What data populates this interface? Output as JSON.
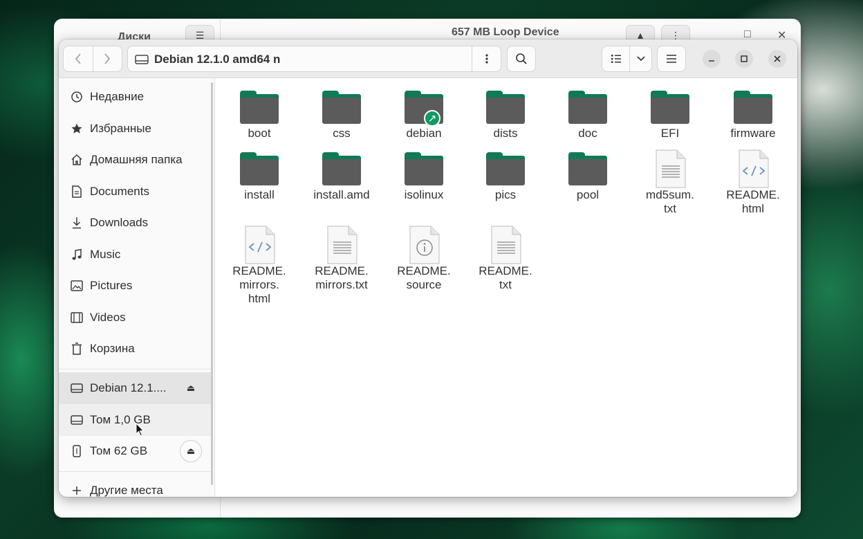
{
  "background_window": {
    "sidebar_title": "Диски",
    "title": "657 MB Loop Device"
  },
  "header": {
    "path": "Debian 12.1.0 amd64 n"
  },
  "sidebar": {
    "items": [
      {
        "label": "Недавние",
        "icon": "clock-icon"
      },
      {
        "label": "Избранные",
        "icon": "star-icon"
      },
      {
        "label": "Домашняя папка",
        "icon": "home-icon"
      },
      {
        "label": "Documents",
        "icon": "document-icon"
      },
      {
        "label": "Downloads",
        "icon": "download-icon"
      },
      {
        "label": "Music",
        "icon": "music-icon"
      },
      {
        "label": "Pictures",
        "icon": "picture-icon"
      },
      {
        "label": "Videos",
        "icon": "video-icon"
      },
      {
        "label": "Корзина",
        "icon": "trash-icon"
      }
    ],
    "devices": [
      {
        "label": "Debian 12.1....",
        "icon": "drive-icon"
      },
      {
        "label": "Том 1,0 GB",
        "icon": "drive-icon"
      },
      {
        "label": "Том 62 GB",
        "icon": "usb-icon"
      }
    ],
    "other_places": "Другие места"
  },
  "files": [
    {
      "name": "boot",
      "type": "folder"
    },
    {
      "name": "css",
      "type": "folder"
    },
    {
      "name": "debian",
      "type": "folder-link"
    },
    {
      "name": "dists",
      "type": "folder"
    },
    {
      "name": "doc",
      "type": "folder"
    },
    {
      "name": "EFI",
      "type": "folder"
    },
    {
      "name": "firmware",
      "type": "folder"
    },
    {
      "name": "install",
      "type": "folder"
    },
    {
      "name": "install.amd",
      "type": "folder"
    },
    {
      "name": "isolinux",
      "type": "folder"
    },
    {
      "name": "pics",
      "type": "folder"
    },
    {
      "name": "pool",
      "type": "folder"
    },
    {
      "name": "md5sum.\ntxt",
      "type": "text"
    },
    {
      "name": "README.\nhtml",
      "type": "html"
    },
    {
      "name": "README.\nmirrors.\nhtml",
      "type": "html"
    },
    {
      "name": "README.\nmirrors.txt",
      "type": "text"
    },
    {
      "name": "README.\nsource",
      "type": "info"
    },
    {
      "name": "README.\ntxt",
      "type": "text"
    }
  ],
  "colors": {
    "folder_tab": "#0f7a53",
    "folder_body": "#5b5b5b",
    "link_badge": "#0f9b63"
  }
}
